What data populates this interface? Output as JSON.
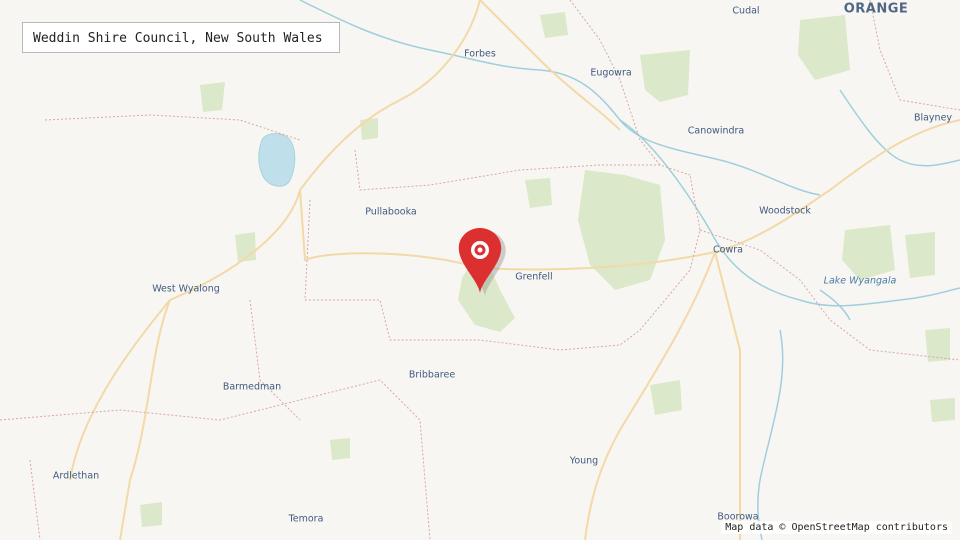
{
  "map": {
    "title": "Weddin Shire Council, New South Wales",
    "attribution": "Map data © OpenStreetMap contributors",
    "marker_icon": "location-pin-icon",
    "colors": {
      "background": "#f8f6f2",
      "water": "#bfe0ea",
      "river": "#9fcfdc",
      "vegetation": "#dbe8c9",
      "road": "#f3d9a8",
      "boundary": "#d7a7a7",
      "marker": "#dc2f2f",
      "label": "#3f5a80"
    },
    "places": [
      {
        "name": "Forbes"
      },
      {
        "name": "Eugowra"
      },
      {
        "name": "Cudal"
      },
      {
        "name": "ORANGE"
      },
      {
        "name": "Blayney"
      },
      {
        "name": "Canowindra"
      },
      {
        "name": "Pullabooka"
      },
      {
        "name": "Woodstock"
      },
      {
        "name": "Cowra"
      },
      {
        "name": "Grenfell"
      },
      {
        "name": "West Wyalong"
      },
      {
        "name": "Lake Wyangala"
      },
      {
        "name": "Barmedman"
      },
      {
        "name": "Bribbaree"
      },
      {
        "name": "Young"
      },
      {
        "name": "Ardlethan"
      },
      {
        "name": "Temora"
      },
      {
        "name": "Boorowa"
      }
    ]
  }
}
